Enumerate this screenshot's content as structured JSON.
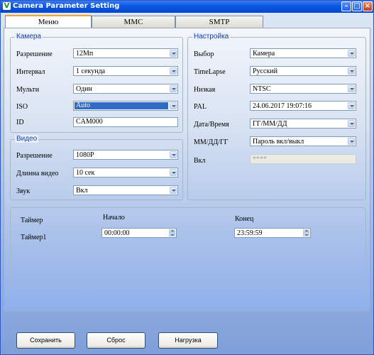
{
  "window": {
    "title": "Camera Parameter Setting",
    "app_icon": "V"
  },
  "tabs": [
    {
      "label": "Меню"
    },
    {
      "label": "MMC"
    },
    {
      "label": "SMTP"
    }
  ],
  "camera": {
    "title": "Камера",
    "resolution": {
      "label": "Разрешение",
      "value": "12Мп"
    },
    "interval": {
      "label": "Интервал",
      "value": "1 секунда"
    },
    "multi": {
      "label": "Мульти",
      "value": "Один"
    },
    "iso": {
      "label": "ISO",
      "value": "Auto"
    },
    "id": {
      "label": "ID",
      "value": "CAM000"
    }
  },
  "video": {
    "title": "Видео",
    "resolution": {
      "label": "Разрешение",
      "value": "1080P"
    },
    "length": {
      "label": "Длинна видео",
      "value": "10 сек"
    },
    "sound": {
      "label": "Звук",
      "value": "Вкл"
    }
  },
  "settings": {
    "title": "Настройка",
    "select": {
      "label": "Выбор",
      "value": "Камера"
    },
    "timelapse": {
      "label": "TimeLapse",
      "value": "Русский"
    },
    "low": {
      "label": "Низкая",
      "value": "NTSC"
    },
    "pal": {
      "label": "PAL",
      "value": "24.06.2017 19:07:16"
    },
    "datetime": {
      "label": "Дата/Время",
      "value": "ГГ/ММ/ДД"
    },
    "format": {
      "label": "ММ/ДД/ГГ",
      "value": "Пароль вкл/выкл"
    },
    "on": {
      "label": "Вкл",
      "value": "****"
    }
  },
  "timer": {
    "header": "Таймер",
    "start_header": "Начало",
    "end_header": "Конец",
    "row_label": "Таймер1",
    "start": "00:00:00",
    "end": "23:59:59"
  },
  "buttons": {
    "save": "Сохранить",
    "reset": "Сброс",
    "load": "Нагрузка"
  }
}
